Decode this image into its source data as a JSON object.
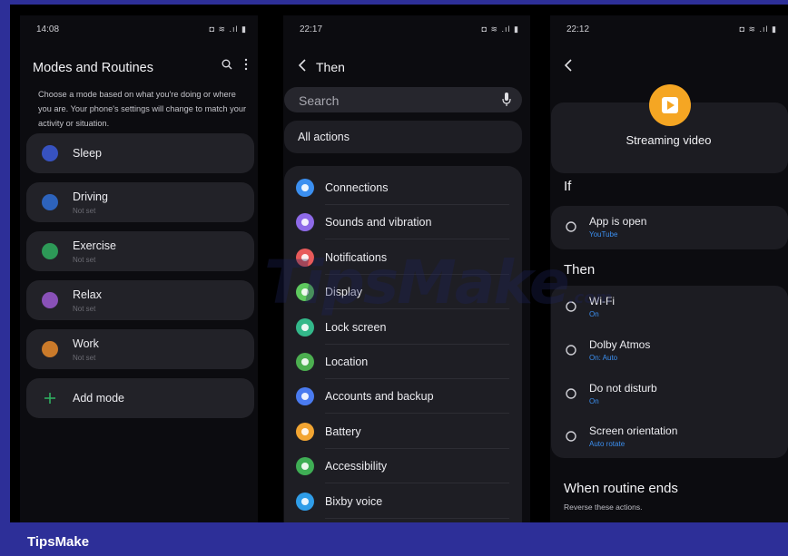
{
  "panel1": {
    "time": "14:08",
    "status_icons": "◘ ≋ .ıl ▮",
    "title": "Modes and Routines",
    "description": "Choose a mode based on what you're doing or where you are. Your phone's settings will change to match your activity or situation.",
    "modes": [
      {
        "name": "Sleep",
        "sub": "",
        "color": "#3b5bdb"
      },
      {
        "name": "Driving",
        "sub": "Not set",
        "color": "#2f6fd6"
      },
      {
        "name": "Exercise",
        "sub": "Not set",
        "color": "#2fae5f"
      },
      {
        "name": "Relax",
        "sub": "Not set",
        "color": "#9b59d0"
      },
      {
        "name": "Work",
        "sub": "Not set",
        "color": "#e8892a"
      },
      {
        "name": "Add mode",
        "sub": "",
        "color": "#2fae5f"
      }
    ]
  },
  "panel2": {
    "time": "22:17",
    "status_icons": "◘ ≋ .ıl ▮",
    "title": "Then",
    "search_placeholder": "Search",
    "all_actions": "All actions",
    "actions": [
      {
        "label": "Connections",
        "color": "#3b8ff0",
        "icon": "wifi-icon"
      },
      {
        "label": "Sounds and vibration",
        "color": "#8e6ae8",
        "icon": "speaker-icon"
      },
      {
        "label": "Notifications",
        "color": "#e85a5a",
        "icon": "bell-icon"
      },
      {
        "label": "Display",
        "color": "#5ec95e",
        "icon": "sun-icon"
      },
      {
        "label": "Lock screen",
        "color": "#33b88a",
        "icon": "lock-icon"
      },
      {
        "label": "Location",
        "color": "#4caf50",
        "icon": "pin-icon"
      },
      {
        "label": "Accounts and backup",
        "color": "#4a7bf0",
        "icon": "sync-icon"
      },
      {
        "label": "Battery",
        "color": "#f2a532",
        "icon": "battery-icon"
      },
      {
        "label": "Accessibility",
        "color": "#3fae55",
        "icon": "accessibility-icon"
      },
      {
        "label": "Bixby voice",
        "color": "#2f9de8",
        "icon": "bixby-icon"
      },
      {
        "label": "",
        "color": "#e8587a",
        "icon": "partial-icon"
      }
    ]
  },
  "panel3": {
    "time": "22:12",
    "status_icons": "◘ ≋ .ıl ▮",
    "routine_name": "Streaming video",
    "if_label": "If",
    "if_conditions": [
      {
        "title": "App is open",
        "sub": "YouTube",
        "icon": "grid-icon"
      }
    ],
    "then_label": "Then",
    "then_actions": [
      {
        "title": "Wi-Fi",
        "sub": "On",
        "icon": "wifi-icon"
      },
      {
        "title": "Dolby Atmos",
        "sub": "On: Auto",
        "icon": "dolby-icon"
      },
      {
        "title": "Do not disturb",
        "sub": "On",
        "icon": "minus-circle-icon"
      },
      {
        "title": "Screen orientation",
        "sub": "Auto rotate",
        "icon": "rotate-icon"
      }
    ],
    "end_label": "When routine ends",
    "end_sub": "Reverse these actions."
  },
  "watermark": "TipsMake",
  "watermark_suffix": ".com",
  "footer": "TipsMake"
}
